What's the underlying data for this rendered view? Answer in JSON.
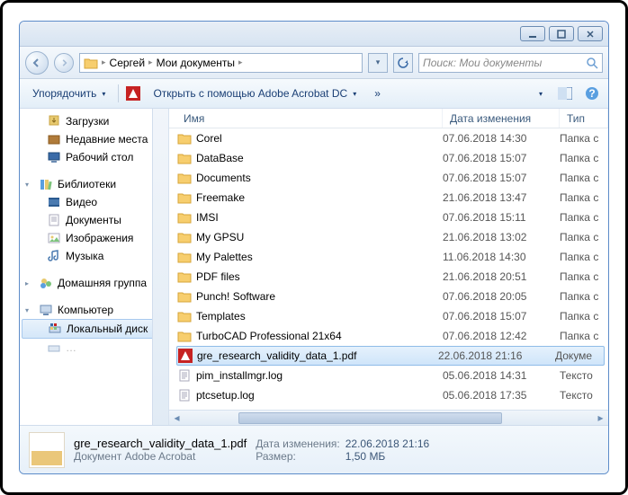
{
  "breadcrumb": {
    "seg1": "Сергей",
    "seg2": "Мои документы"
  },
  "search": {
    "placeholder": "Поиск: Мои документы"
  },
  "toolbar": {
    "organize": "Упорядочить",
    "open_with": "Открыть с помощью Adobe Acrobat DC",
    "more": "»"
  },
  "sidebar": {
    "downloads": "Загрузки",
    "recent": "Недавние места",
    "desktop": "Рабочий стол",
    "libraries": "Библиотеки",
    "video": "Видео",
    "documents": "Документы",
    "pictures": "Изображения",
    "music": "Музыка",
    "homegroup": "Домашняя группа",
    "computer": "Компьютер",
    "localdisk": "Локальный диск"
  },
  "columns": {
    "name": "Имя",
    "date": "Дата изменения",
    "type": "Тип"
  },
  "files": [
    {
      "name": "Corel",
      "date": "07.06.2018 14:30",
      "type": "Папка с",
      "kind": "folder"
    },
    {
      "name": "DataBase",
      "date": "07.06.2018 15:07",
      "type": "Папка с",
      "kind": "folder"
    },
    {
      "name": "Documents",
      "date": "07.06.2018 15:07",
      "type": "Папка с",
      "kind": "folder"
    },
    {
      "name": "Freemake",
      "date": "21.06.2018 13:47",
      "type": "Папка с",
      "kind": "folder"
    },
    {
      "name": "IMSI",
      "date": "07.06.2018 15:11",
      "type": "Папка с",
      "kind": "folder"
    },
    {
      "name": "My GPSU",
      "date": "21.06.2018 13:02",
      "type": "Папка с",
      "kind": "folder"
    },
    {
      "name": "My Palettes",
      "date": "11.06.2018 14:30",
      "type": "Папка с",
      "kind": "folder"
    },
    {
      "name": "PDF files",
      "date": "21.06.2018 20:51",
      "type": "Папка с",
      "kind": "folder"
    },
    {
      "name": "Punch! Software",
      "date": "07.06.2018 20:05",
      "type": "Папка с",
      "kind": "folder"
    },
    {
      "name": "Templates",
      "date": "07.06.2018 15:07",
      "type": "Папка с",
      "kind": "folder"
    },
    {
      "name": "TurboCAD Professional 21x64",
      "date": "07.06.2018 12:42",
      "type": "Папка с",
      "kind": "folder"
    },
    {
      "name": "gre_research_validity_data_1.pdf",
      "date": "22.06.2018 21:16",
      "type": "Докуме",
      "kind": "pdf",
      "selected": true
    },
    {
      "name": "pim_installmgr.log",
      "date": "05.06.2018 14:31",
      "type": "Тексто",
      "kind": "log"
    },
    {
      "name": "ptcsetup.log",
      "date": "05.06.2018 17:35",
      "type": "Тексто",
      "kind": "log"
    }
  ],
  "details": {
    "filename": "gre_research_validity_data_1.pdf",
    "filetype": "Документ Adobe Acrobat",
    "mod_label": "Дата изменения:",
    "mod_value": "22.06.2018 21:16",
    "size_label": "Размер:",
    "size_value": "1,50 МБ"
  }
}
